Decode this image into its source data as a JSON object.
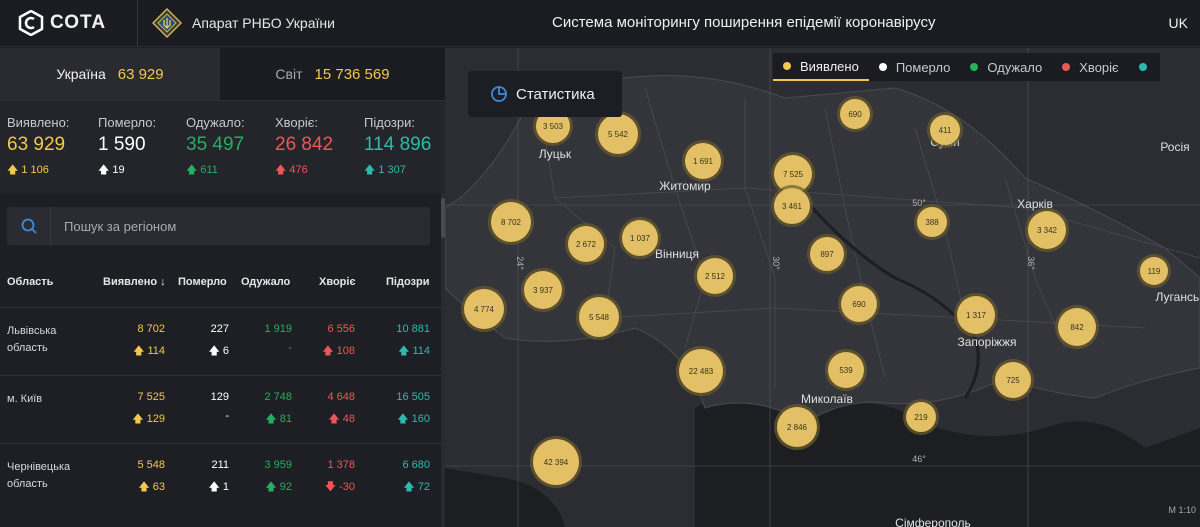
{
  "header": {
    "logo_text": "СОТА",
    "org_name": "Апарат РНБО України",
    "title": "Система моніторингу поширення епідемії коронавірусу",
    "language": "UK"
  },
  "scope_tabs": [
    {
      "name": "Україна",
      "value": "63 929"
    },
    {
      "name": "Світ",
      "value": "15 736 569"
    }
  ],
  "summary": [
    {
      "label": "Виявлено:",
      "value": "63 929",
      "delta": "1 106",
      "color": "#f2c94c"
    },
    {
      "label": "Померло:",
      "value": "1 590",
      "delta": "19",
      "color": "#ffffff"
    },
    {
      "label": "Одужало:",
      "value": "35 497",
      "delta": "611",
      "color": "#27ae60"
    },
    {
      "label": "Хворіє:",
      "value": "26 842",
      "delta": "476",
      "color": "#eb5757"
    },
    {
      "label": "Підозри:",
      "value": "114 896",
      "delta": "1 307",
      "color": "#2bbbad"
    }
  ],
  "search": {
    "placeholder": "Пошук за регіоном"
  },
  "table": {
    "headers": [
      "Область",
      "Виявлено",
      "Померло",
      "Одужало",
      "Хворіє",
      "Підозри"
    ],
    "rows": [
      {
        "region": "Львівська область",
        "detected": "8 702",
        "detected_d": "114",
        "died": "227",
        "died_d": "6",
        "recovered": "1 919",
        "recovered_d": "-",
        "sick": "6 556",
        "sick_d": "108",
        "suspect": "10 881",
        "suspect_d": "114"
      },
      {
        "region": "м. Київ",
        "detected": "7 525",
        "detected_d": "129",
        "died": "129",
        "died_d": "-",
        "recovered": "2 748",
        "recovered_d": "81",
        "sick": "4 648",
        "sick_d": "48",
        "suspect": "16 505",
        "suspect_d": "160"
      },
      {
        "region": "Чернівецька область",
        "detected": "5 548",
        "detected_d": "63",
        "died": "211",
        "died_d": "1",
        "recovered": "3 959",
        "recovered_d": "92",
        "sick": "1 378",
        "sick_d": "-30",
        "suspect": "6 680",
        "suspect_d": "72"
      }
    ]
  },
  "map": {
    "stat_button": "Статистика",
    "legend": [
      {
        "label": "Виявлено",
        "color": "#f2c94c"
      },
      {
        "label": "Померло",
        "color": "#ffffff"
      },
      {
        "label": "Одужало",
        "color": "#27ae60"
      },
      {
        "label": "Хворіє",
        "color": "#eb5757"
      },
      {
        "label": "",
        "color": "#2bbbad"
      }
    ],
    "cities": [
      "Луцьк",
      "Житомир",
      "Суми",
      "Харків",
      "Вінниця",
      "Запоріжжя",
      "Луганськ",
      "Миколаїв",
      "Сімферополь",
      "Росія"
    ],
    "grid_labels": [
      "50°",
      "24°",
      "30°",
      "36°",
      "46°"
    ],
    "bubbles": [
      "3 503",
      "5 542",
      "690",
      "411",
      "1 691",
      "7 525",
      "3 461",
      "8 702",
      "2 672",
      "1 037",
      "388",
      "3 342",
      "2 512",
      "897",
      "3 937",
      "4 774",
      "5 548",
      "690",
      "1 317",
      "842",
      "119",
      "22 483",
      "539",
      "725",
      "219",
      "2 846",
      "42 394"
    ],
    "scale_text": "М 1:10"
  }
}
